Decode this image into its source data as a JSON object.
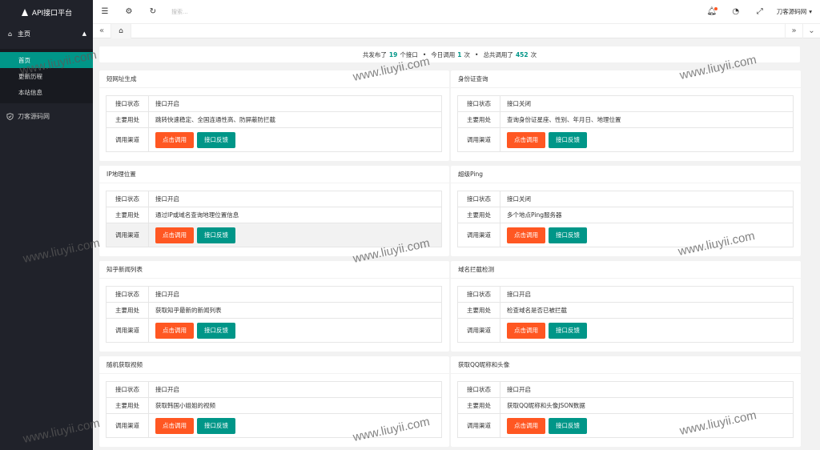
{
  "app": {
    "title": "API接口平台"
  },
  "sidebar": {
    "group_label": "主页",
    "items": [
      {
        "label": "首页",
        "active": true
      },
      {
        "label": "更新历程",
        "active": false
      },
      {
        "label": "本站信息",
        "active": false
      }
    ],
    "other_label": "刀客源码网"
  },
  "header": {
    "search_placeholder": "搜索...",
    "user_name": "刀客源码网"
  },
  "stats": {
    "prefix": "共发布了",
    "api_count": "19",
    "api_unit": "个接口",
    "today_prefix": "今日调用",
    "today_count": "1",
    "today_unit": "次",
    "total_prefix": "总共调用了",
    "total_count": "452",
    "total_unit": "次"
  },
  "labels": {
    "status": "接口状态",
    "usage": "主要用处",
    "channel": "调用渠道",
    "call": "点击调用",
    "feedback": "接口反馈"
  },
  "cards": [
    {
      "title": "短网址生成",
      "status": "接口开启",
      "desc": "跳转快速稳定、全国连通性高、防屏蔽防拦截"
    },
    {
      "title": "身份证查询",
      "status": "接口关闭",
      "desc": "查询身份证星座、性别、年月日、地理位置"
    },
    {
      "title": "IP地理位置",
      "status": "接口开启",
      "desc": "通过IP或域名查询地理位置信息"
    },
    {
      "title": "超级Ping",
      "status": "接口关闭",
      "desc": "多个地点Ping服务器"
    },
    {
      "title": "知乎新闻列表",
      "status": "接口开启",
      "desc": "获取知乎最新的新闻列表"
    },
    {
      "title": "域名拦截检测",
      "status": "接口开启",
      "desc": "检查域名是否已被拦截"
    },
    {
      "title": "随机获取视频",
      "status": "接口开启",
      "desc": "获取韩国小姐姐的视频"
    },
    {
      "title": "获取QQ昵称和头像",
      "status": "接口开启",
      "desc": "获取QQ昵称和头像JSON数据"
    }
  ],
  "watermark": "www.liuyii.com",
  "colors": {
    "accent": "#009688",
    "danger": "#ff5722",
    "sidebar": "#20222a"
  }
}
